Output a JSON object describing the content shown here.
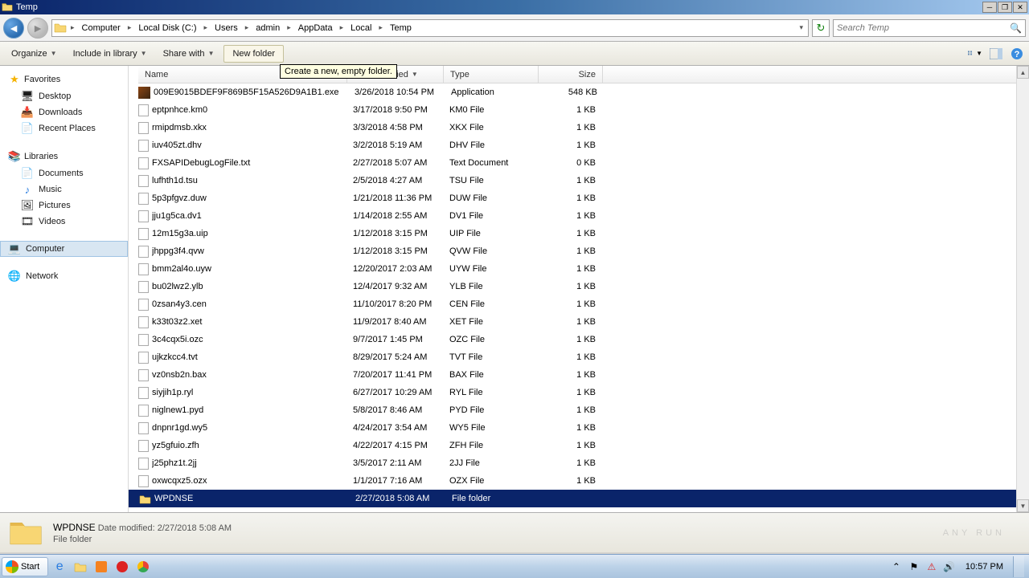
{
  "window": {
    "title": "Temp"
  },
  "breadcrumb": [
    "Computer",
    "Local Disk (C:)",
    "Users",
    "admin",
    "AppData",
    "Local",
    "Temp"
  ],
  "search": {
    "placeholder": "Search Temp"
  },
  "toolbar": {
    "organize": "Organize",
    "include": "Include in library",
    "share": "Share with",
    "newfolder": "New folder",
    "tooltip": "Create a new, empty folder."
  },
  "nav": {
    "favorites": {
      "label": "Favorites",
      "items": [
        "Desktop",
        "Downloads",
        "Recent Places"
      ]
    },
    "libraries": {
      "label": "Libraries",
      "items": [
        "Documents",
        "Music",
        "Pictures",
        "Videos"
      ]
    },
    "computer": "Computer",
    "network": "Network"
  },
  "columns": {
    "name": "Name",
    "date": "Date modified",
    "type": "Type",
    "size": "Size"
  },
  "files": [
    {
      "icon": "exe",
      "name": "009E9015BDEF9F869B5F15A526D9A1B1.exe",
      "date": "3/26/2018 10:54 PM",
      "type": "Application",
      "size": "548 KB"
    },
    {
      "icon": "doc",
      "name": "eptpnhce.km0",
      "date": "3/17/2018 9:50 PM",
      "type": "KM0 File",
      "size": "1 KB"
    },
    {
      "icon": "doc",
      "name": "rmipdmsb.xkx",
      "date": "3/3/2018 4:58 PM",
      "type": "XKX File",
      "size": "1 KB"
    },
    {
      "icon": "doc",
      "name": "iuv405zt.dhv",
      "date": "3/2/2018 5:19 AM",
      "type": "DHV File",
      "size": "1 KB"
    },
    {
      "icon": "doc",
      "name": "FXSAPIDebugLogFile.txt",
      "date": "2/27/2018 5:07 AM",
      "type": "Text Document",
      "size": "0 KB"
    },
    {
      "icon": "doc",
      "name": "lufhth1d.tsu",
      "date": "2/5/2018 4:27 AM",
      "type": "TSU File",
      "size": "1 KB"
    },
    {
      "icon": "doc",
      "name": "5p3pfgvz.duw",
      "date": "1/21/2018 11:36 PM",
      "type": "DUW File",
      "size": "1 KB"
    },
    {
      "icon": "doc",
      "name": "jju1g5ca.dv1",
      "date": "1/14/2018 2:55 AM",
      "type": "DV1 File",
      "size": "1 KB"
    },
    {
      "icon": "doc",
      "name": "12m15g3a.uip",
      "date": "1/12/2018 3:15 PM",
      "type": "UIP File",
      "size": "1 KB"
    },
    {
      "icon": "doc",
      "name": "jhppg3f4.qvw",
      "date": "1/12/2018 3:15 PM",
      "type": "QVW File",
      "size": "1 KB"
    },
    {
      "icon": "doc",
      "name": "bmm2al4o.uyw",
      "date": "12/20/2017 2:03 AM",
      "type": "UYW File",
      "size": "1 KB"
    },
    {
      "icon": "doc",
      "name": "bu02lwz2.ylb",
      "date": "12/4/2017 9:32 AM",
      "type": "YLB File",
      "size": "1 KB"
    },
    {
      "icon": "doc",
      "name": "0zsan4y3.cen",
      "date": "11/10/2017 8:20 PM",
      "type": "CEN File",
      "size": "1 KB"
    },
    {
      "icon": "doc",
      "name": "k33t03z2.xet",
      "date": "11/9/2017 8:40 AM",
      "type": "XET File",
      "size": "1 KB"
    },
    {
      "icon": "doc",
      "name": "3c4cqx5i.ozc",
      "date": "9/7/2017 1:45 PM",
      "type": "OZC File",
      "size": "1 KB"
    },
    {
      "icon": "doc",
      "name": "ujkzkcc4.tvt",
      "date": "8/29/2017 5:24 AM",
      "type": "TVT File",
      "size": "1 KB"
    },
    {
      "icon": "doc",
      "name": "vz0nsb2n.bax",
      "date": "7/20/2017 11:41 PM",
      "type": "BAX File",
      "size": "1 KB"
    },
    {
      "icon": "doc",
      "name": "siyjih1p.ryl",
      "date": "6/27/2017 10:29 AM",
      "type": "RYL File",
      "size": "1 KB"
    },
    {
      "icon": "doc",
      "name": "niglnew1.pyd",
      "date": "5/8/2017 8:46 AM",
      "type": "PYD File",
      "size": "1 KB"
    },
    {
      "icon": "doc",
      "name": "dnpnr1gd.wy5",
      "date": "4/24/2017 3:54 AM",
      "type": "WY5 File",
      "size": "1 KB"
    },
    {
      "icon": "doc",
      "name": "yz5gfuio.zfh",
      "date": "4/22/2017 4:15 PM",
      "type": "ZFH File",
      "size": "1 KB"
    },
    {
      "icon": "doc",
      "name": "j25phz1t.2jj",
      "date": "3/5/2017 2:11 AM",
      "type": "2JJ File",
      "size": "1 KB"
    },
    {
      "icon": "doc",
      "name": "oxwcqxz5.ozx",
      "date": "1/1/2017 7:16 AM",
      "type": "OZX File",
      "size": "1 KB"
    },
    {
      "icon": "folder",
      "name": "WPDNSE",
      "date": "2/27/2018 5:08 AM",
      "type": "File folder",
      "size": "",
      "selected": true
    }
  ],
  "details": {
    "name": "WPDNSE",
    "meta1": "Date modified: 2/27/2018 5:08 AM",
    "meta2": "File folder"
  },
  "taskbar": {
    "start": "Start",
    "clock": "10:57 PM"
  },
  "watermark": "ANY      RUN"
}
